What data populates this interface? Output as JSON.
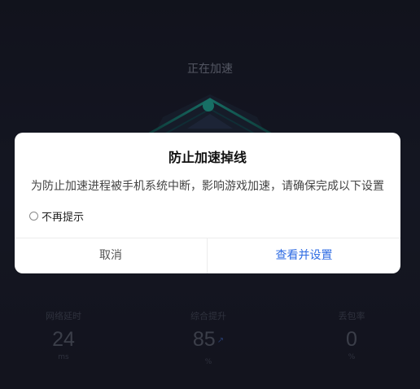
{
  "status": {
    "label": "正在加速"
  },
  "metrics": [
    {
      "label": "网络延时",
      "value": "24",
      "unit": "ms"
    },
    {
      "label": "综合提升",
      "value": "85",
      "unit": "%",
      "trend": "↗"
    },
    {
      "label": "丢包率",
      "value": "0",
      "unit": "%"
    }
  ],
  "dialog": {
    "title": "防止加速掉线",
    "message": "为防止加速进程被手机系统中断，影响游戏加速，请确保完成以下设置",
    "checkbox_label": "不再提示",
    "cancel_label": "取消",
    "confirm_label": "查看并设置"
  },
  "colors": {
    "accent": "#2d6be3",
    "gauge_teal": "#1fb6a0"
  }
}
